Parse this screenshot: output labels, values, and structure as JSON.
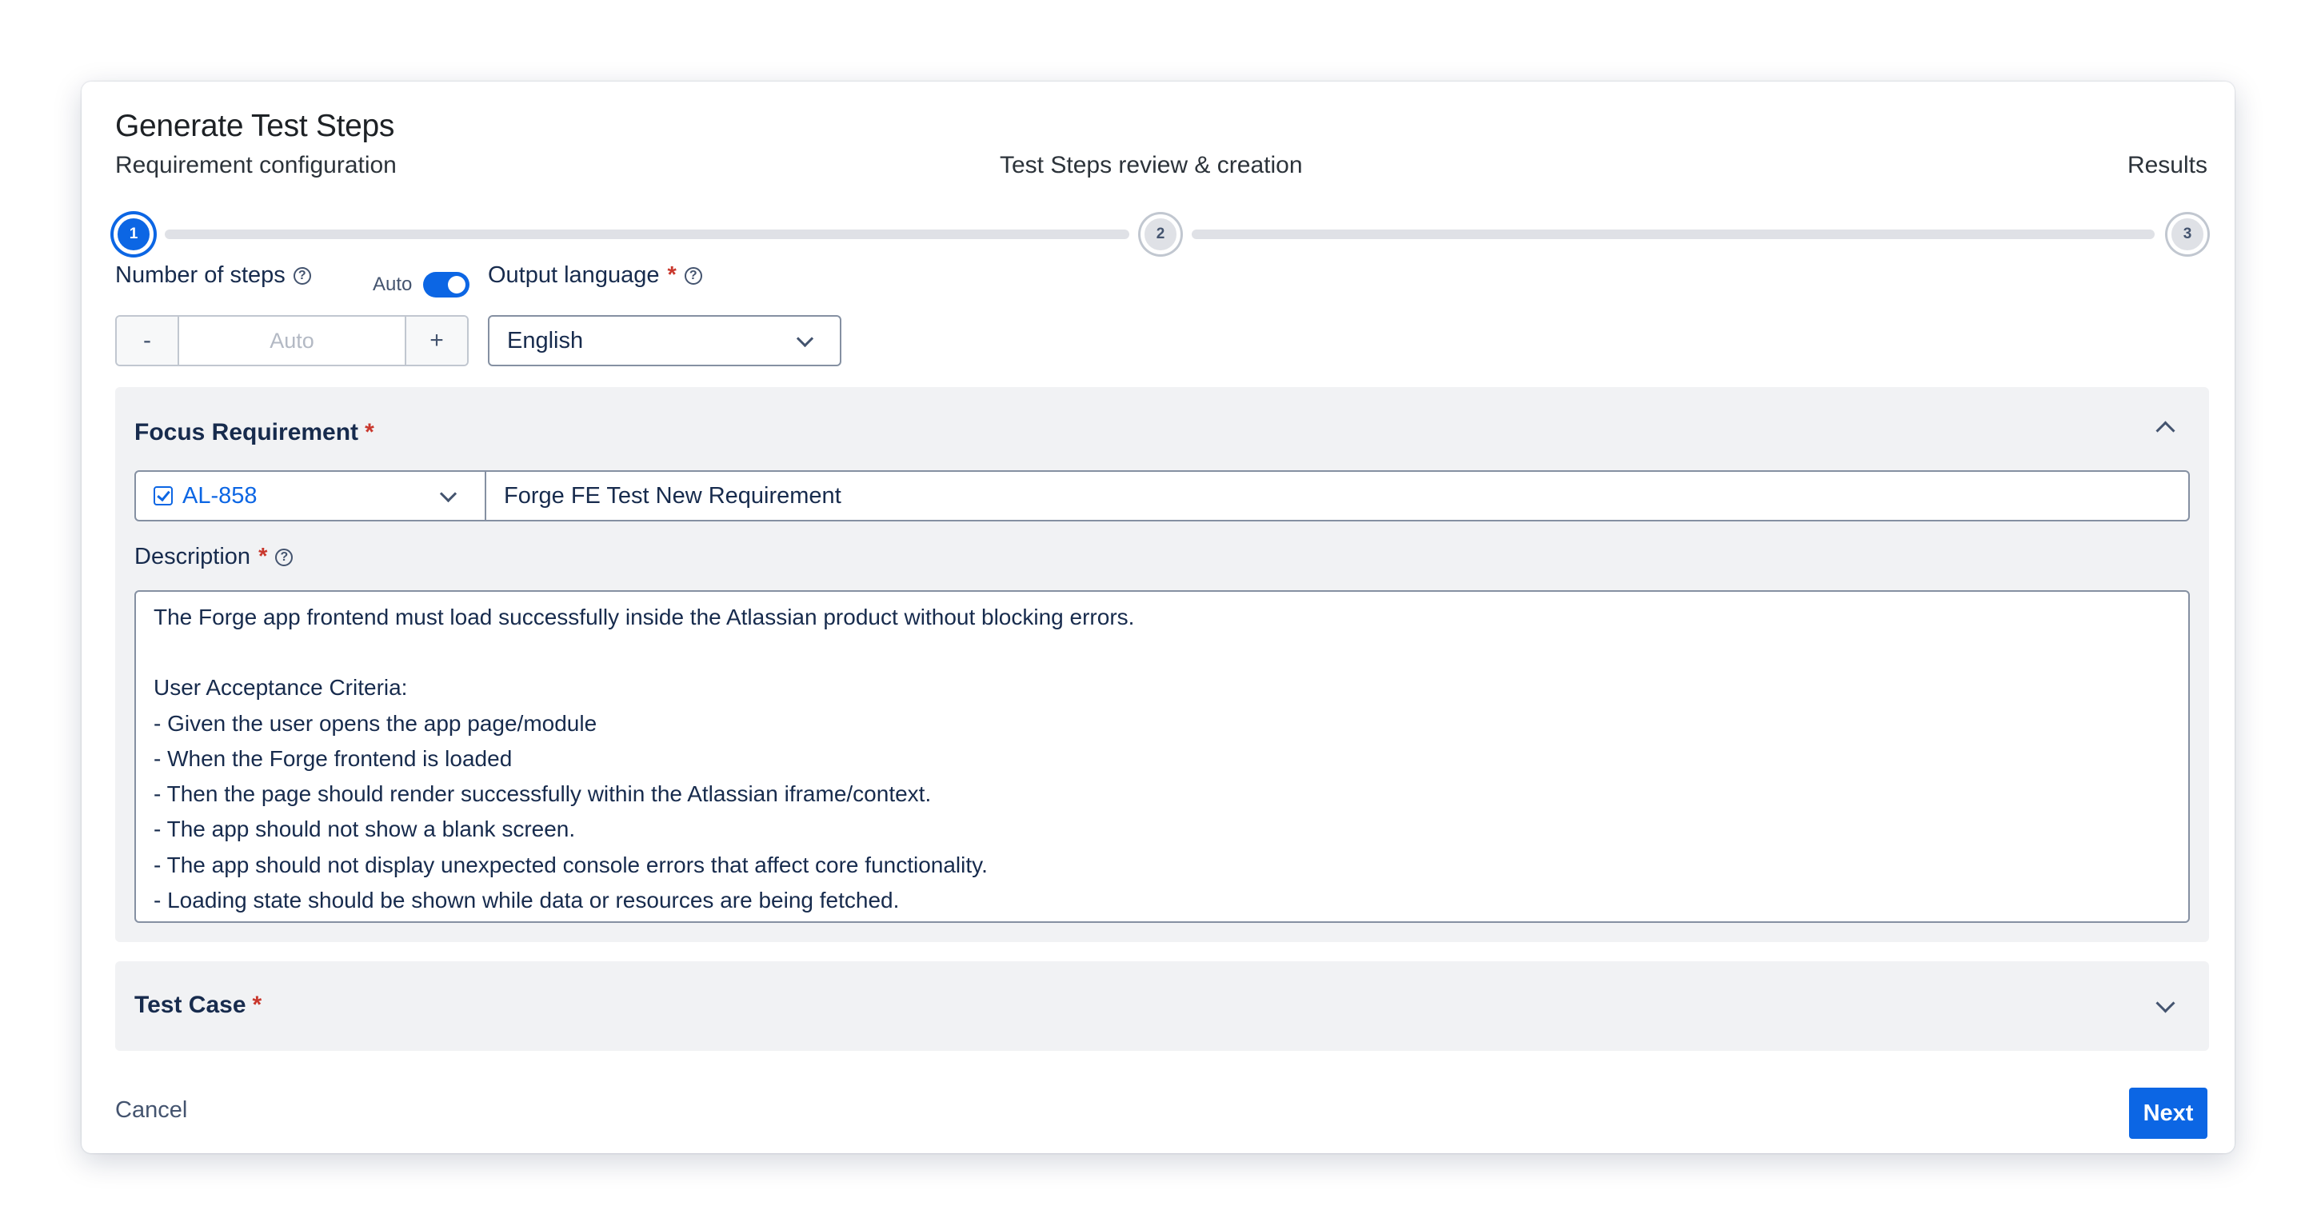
{
  "modal": {
    "title": "Generate Test Steps"
  },
  "stepper": {
    "steps": [
      {
        "label": "Requirement configuration",
        "number": "1"
      },
      {
        "label": "Test Steps review & creation",
        "number": "2"
      },
      {
        "label": "Results",
        "number": "3"
      }
    ],
    "current_step": 1
  },
  "form": {
    "number_of_steps": {
      "label": "Number of steps",
      "auto_label": "Auto",
      "auto_enabled": true,
      "minus_label": "-",
      "plus_label": "+",
      "placeholder": "Auto"
    },
    "output_language": {
      "label": "Output language",
      "required_mark": "*",
      "value": "English"
    }
  },
  "focus_requirement": {
    "title": "Focus Requirement",
    "required_mark": "*",
    "issue_key": "AL-858",
    "issue_summary": "Forge FE Test New Requirement",
    "description_label": "Description",
    "description_required_mark": "*",
    "description_lines": [
      "The Forge app frontend must load successfully inside the Atlassian product without blocking errors.",
      "",
      "User Acceptance Criteria:",
      "- Given the user opens the app page/module",
      "- When the Forge frontend is loaded",
      "- Then the page should render successfully within the Atlassian iframe/context.",
      "- The app should not show a blank screen.",
      "- The app should not display unexpected console errors that affect core functionality.",
      "- Loading state should be shown while data or resources are being fetched."
    ]
  },
  "test_case": {
    "title": "Test Case",
    "required_mark": "*"
  },
  "footer": {
    "cancel_label": "Cancel",
    "next_label": "Next"
  },
  "colors": {
    "primary": "#0c66e4",
    "required": "#c9372c",
    "panel_bg": "#f1f2f4"
  }
}
